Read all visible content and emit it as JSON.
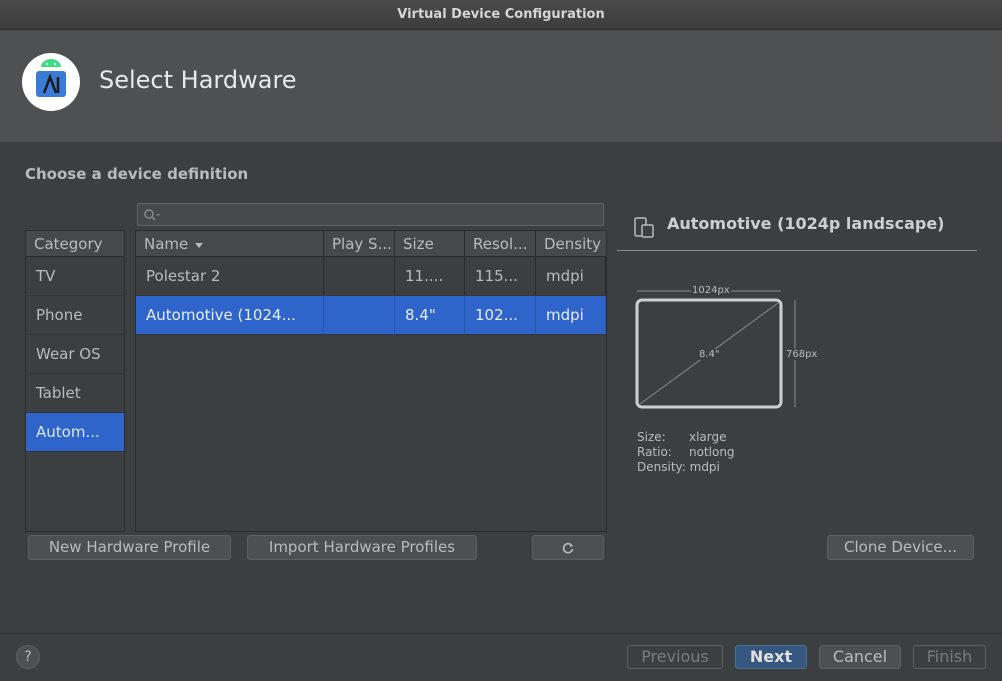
{
  "window": {
    "title": "Virtual Device Configuration"
  },
  "header": {
    "title": "Select Hardware",
    "logo_icon": "android-studio-icon"
  },
  "main": {
    "section_title": "Choose a device definition",
    "search": {
      "value": "",
      "placeholder": ""
    },
    "category": {
      "header": "Category",
      "items": [
        {
          "label": "TV"
        },
        {
          "label": "Phone"
        },
        {
          "label": "Wear OS"
        },
        {
          "label": "Tablet"
        },
        {
          "label": "Autom..."
        }
      ],
      "selected_index": 4
    },
    "table": {
      "columns": [
        "Name",
        "Play S...",
        "Size",
        "Resol...",
        "Density"
      ],
      "rows": [
        {
          "name": "Polestar 2",
          "play": "",
          "size": "11....",
          "resolution": "115...",
          "density": "mdpi"
        },
        {
          "name": "Automotive (1024...",
          "play": "",
          "size": "8.4\"",
          "resolution": "102...",
          "density": "mdpi"
        }
      ],
      "selected_index": 1
    },
    "buttons": {
      "new_profile": "New Hardware Profile",
      "import_profiles": "Import Hardware Profiles",
      "refresh_icon": "refresh-icon",
      "clone": "Clone Device..."
    },
    "preview": {
      "title": "Automotive (1024p landscape)",
      "width_label": "1024px",
      "height_label": "768px",
      "diagonal_label": "8.4\"",
      "specs": [
        {
          "label": "Size:",
          "value": "xlarge"
        },
        {
          "label": "Ratio:",
          "value": "notlong"
        },
        {
          "label": "Density:",
          "value": "mdpi"
        }
      ]
    }
  },
  "footer": {
    "help": "?",
    "previous": "Previous",
    "next": "Next",
    "cancel": "Cancel",
    "finish": "Finish"
  },
  "colors": {
    "selection": "#2f65ca",
    "background": "#3c3f41",
    "header_bg": "#4e5052",
    "primary_button": "#365880"
  }
}
